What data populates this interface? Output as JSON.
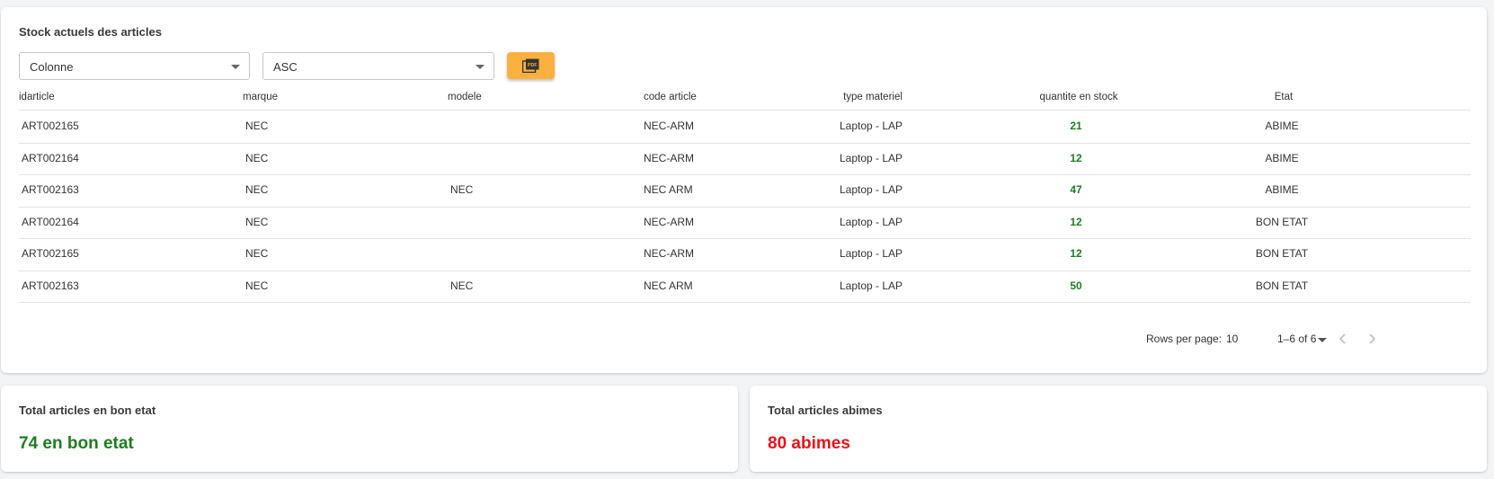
{
  "main": {
    "title": "Stock actuels des articles",
    "column_select": {
      "value": "Colonne"
    },
    "order_select": {
      "value": "ASC"
    },
    "pdf_button": {
      "icon": "pdf-icon",
      "color": "#fbb040"
    },
    "headers": [
      "idarticle",
      "marque",
      "modele",
      "code article",
      "type materiel",
      "quantite en stock",
      "Etat"
    ],
    "rows": [
      [
        "ART002165",
        "NEC",
        "",
        "NEC-ARM",
        "Laptop - LAP",
        "21",
        "ABIME"
      ],
      [
        "ART002164",
        "NEC",
        "",
        "NEC-ARM",
        "Laptop - LAP",
        "12",
        "ABIME"
      ],
      [
        "ART002163",
        "NEC",
        "NEC",
        "NEC ARM",
        "Laptop - LAP",
        "47",
        "ABIME"
      ],
      [
        "ART002164",
        "NEC",
        "",
        "NEC-ARM",
        "Laptop - LAP",
        "12",
        "BON ETAT"
      ],
      [
        "ART002165",
        "NEC",
        "",
        "NEC-ARM",
        "Laptop - LAP",
        "12",
        "BON ETAT"
      ],
      [
        "ART002163",
        "NEC",
        "NEC",
        "NEC ARM",
        "Laptop - LAP",
        "50",
        "BON ETAT"
      ]
    ],
    "pagination": {
      "rows_per_page_label": "Rows per page:",
      "rows_per_page_value": "10",
      "range": "1–6 of 6"
    }
  },
  "summary": {
    "good": {
      "title": "Total articles en bon etat",
      "value": "74 en bon etat",
      "color": "#1e7d1e"
    },
    "damaged": {
      "title": "Total articles abimes",
      "value": "80 abimes",
      "color": "#e8141b"
    }
  },
  "colors": {
    "quantity": "#1e7d1e",
    "accent": "#fbb040"
  }
}
